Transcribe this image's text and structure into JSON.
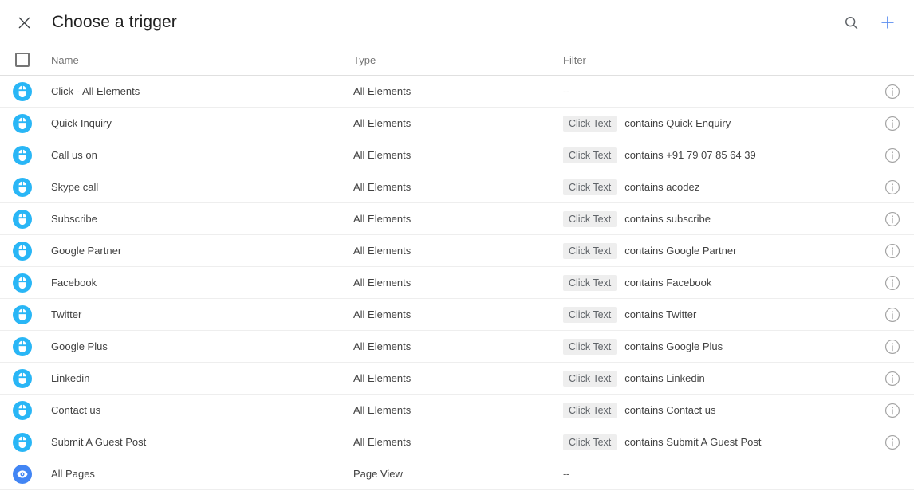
{
  "header": {
    "close_icon": "close-icon",
    "title": "Choose a trigger",
    "search_icon": "search-icon",
    "add_icon": "plus-icon",
    "accent_color": "#5b8def",
    "search_color": "#5f6368"
  },
  "table": {
    "columns": {
      "name": "Name",
      "type": "Type",
      "filter": "Filter"
    },
    "select_all_checked": false,
    "info_icon": "info-icon",
    "chip_label": "Click Text",
    "empty_filter": "--",
    "icon_colors": {
      "click": "#29b6f6",
      "pageview": "#4285f4"
    },
    "rows": [
      {
        "icon": "mouse-click-icon",
        "icon_kind": "click",
        "name": "Click - All Elements",
        "type": "All Elements",
        "filter_chip": "",
        "filter_text": "--",
        "has_info": true
      },
      {
        "icon": "mouse-click-icon",
        "icon_kind": "click",
        "name": "Quick Inquiry",
        "type": "All Elements",
        "filter_chip": "Click Text",
        "filter_text": "contains Quick Enquiry",
        "has_info": true
      },
      {
        "icon": "mouse-click-icon",
        "icon_kind": "click",
        "name": "Call us on",
        "type": "All Elements",
        "filter_chip": "Click Text",
        "filter_text": "contains +91 79 07 85 64 39",
        "has_info": true
      },
      {
        "icon": "mouse-click-icon",
        "icon_kind": "click",
        "name": "Skype call",
        "type": "All Elements",
        "filter_chip": "Click Text",
        "filter_text": "contains acodez",
        "has_info": true
      },
      {
        "icon": "mouse-click-icon",
        "icon_kind": "click",
        "name": "Subscribe",
        "type": "All Elements",
        "filter_chip": "Click Text",
        "filter_text": "contains subscribe",
        "has_info": true
      },
      {
        "icon": "mouse-click-icon",
        "icon_kind": "click",
        "name": "Google Partner",
        "type": "All Elements",
        "filter_chip": "Click Text",
        "filter_text": "contains Google Partner",
        "has_info": true
      },
      {
        "icon": "mouse-click-icon",
        "icon_kind": "click",
        "name": "Facebook",
        "type": "All Elements",
        "filter_chip": "Click Text",
        "filter_text": "contains Facebook",
        "has_info": true
      },
      {
        "icon": "mouse-click-icon",
        "icon_kind": "click",
        "name": "Twitter",
        "type": "All Elements",
        "filter_chip": "Click Text",
        "filter_text": "contains Twitter",
        "has_info": true
      },
      {
        "icon": "mouse-click-icon",
        "icon_kind": "click",
        "name": "Google Plus",
        "type": "All Elements",
        "filter_chip": "Click Text",
        "filter_text": "contains Google Plus",
        "has_info": true
      },
      {
        "icon": "mouse-click-icon",
        "icon_kind": "click",
        "name": "Linkedin",
        "type": "All Elements",
        "filter_chip": "Click Text",
        "filter_text": "contains Linkedin",
        "has_info": true
      },
      {
        "icon": "mouse-click-icon",
        "icon_kind": "click",
        "name": "Contact us",
        "type": "All Elements",
        "filter_chip": "Click Text",
        "filter_text": "contains Contact us",
        "has_info": true
      },
      {
        "icon": "mouse-click-icon",
        "icon_kind": "click",
        "name": "Submit A Guest Post",
        "type": "All Elements",
        "filter_chip": "Click Text",
        "filter_text": "contains Submit A Guest Post",
        "has_info": true
      },
      {
        "icon": "page-view-eye-icon",
        "icon_kind": "pageview",
        "name": "All Pages",
        "type": "Page View",
        "filter_chip": "",
        "filter_text": "--",
        "has_info": false
      }
    ]
  }
}
